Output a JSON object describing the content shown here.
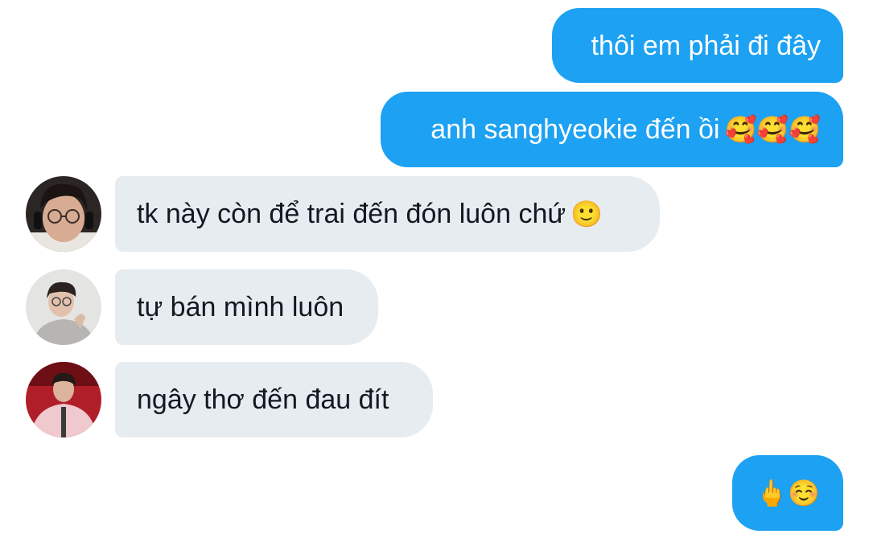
{
  "messages": [
    {
      "side": "out",
      "text": "thôi em phải đi đây",
      "emoji": ""
    },
    {
      "side": "out",
      "text": "anh sanghyeokie đến ồi",
      "emoji": "🥰🥰🥰"
    },
    {
      "side": "in",
      "text": "tk này còn để trai đến đón luôn chứ",
      "emoji": "🙂"
    },
    {
      "side": "in",
      "text": "tự bán mình luôn",
      "emoji": ""
    },
    {
      "side": "in",
      "text": "ngây thơ đến đau đít",
      "emoji": ""
    },
    {
      "side": "out",
      "text": "",
      "emoji": "🖕☺️"
    }
  ],
  "colors": {
    "outgoing_bubble": "#1da1f2",
    "incoming_bubble": "#e7ecf0",
    "background": "#ffffff"
  },
  "avatar_icons": [
    "user-avatar-glasses-headset",
    "user-avatar-grey-hoodie",
    "user-avatar-pink-jacket"
  ]
}
